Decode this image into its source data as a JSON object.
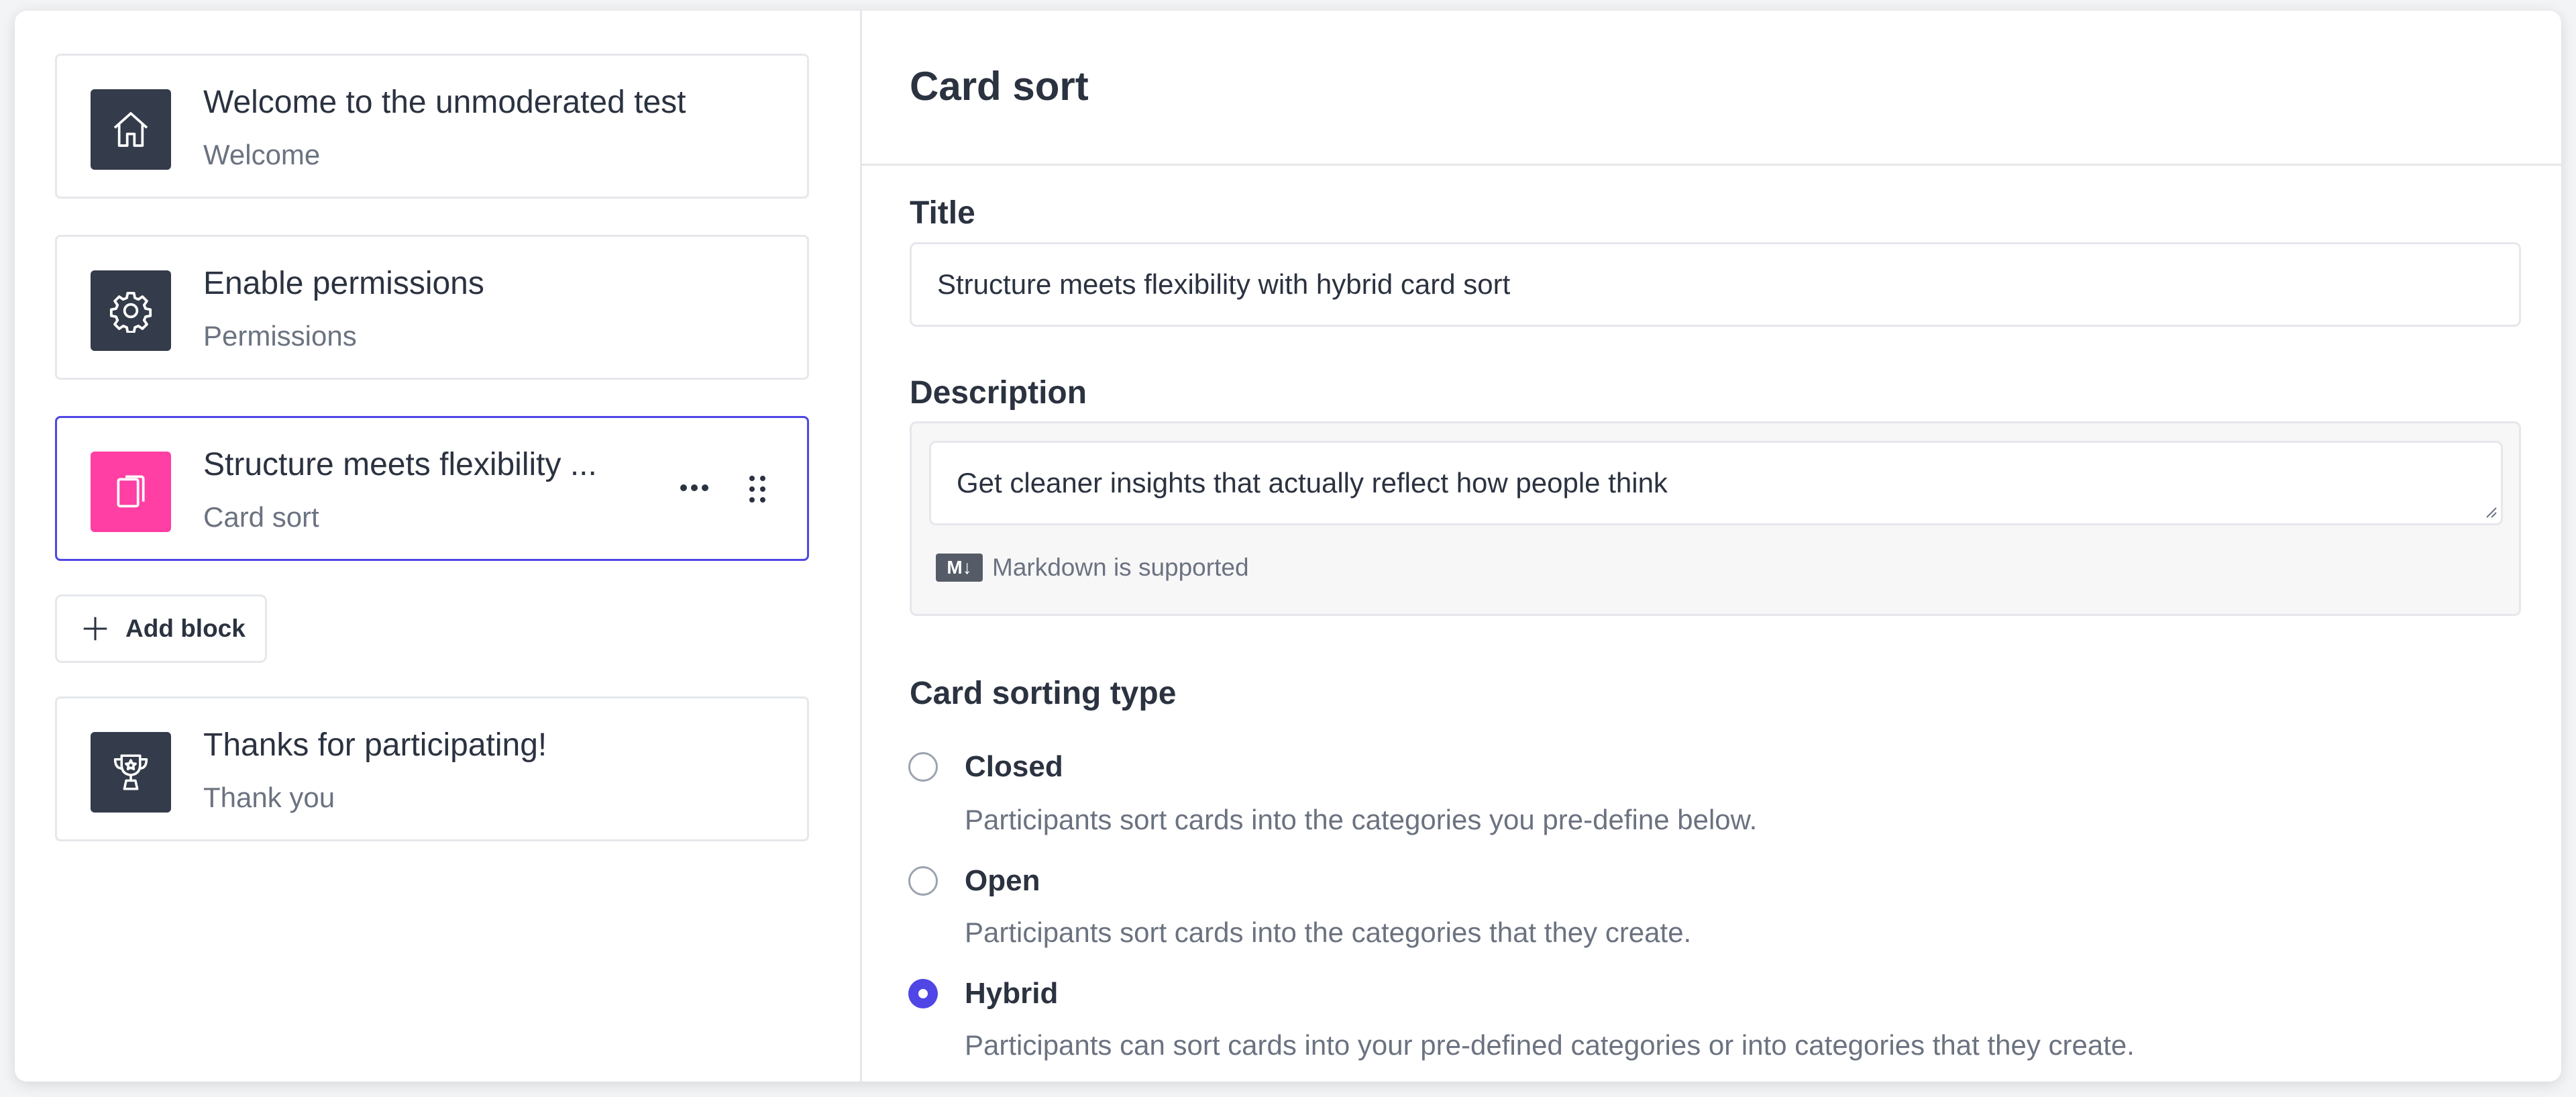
{
  "blocks": [
    {
      "title": "Welcome to the unmoderated test",
      "subtitle": "Welcome",
      "icon": "home-icon"
    },
    {
      "title": "Enable permissions",
      "subtitle": "Permissions",
      "icon": "gear-icon"
    },
    {
      "title": "Structure meets flexibility ...",
      "subtitle": "Card sort",
      "icon": "cards-icon",
      "selected": true
    },
    {
      "title": "Thanks for participating!",
      "subtitle": "Thank you",
      "icon": "trophy-icon"
    }
  ],
  "add_block_label": "Add block",
  "panel": {
    "title": "Card sort",
    "title_label": "Title",
    "title_value": "Structure meets flexibility with hybrid card sort",
    "description_label": "Description",
    "description_value": "Get cleaner insights that actually reflect how people think",
    "markdown_badge": "M↓",
    "markdown_note": "Markdown is supported",
    "sorting_type_label": "Card sorting type",
    "options": [
      {
        "label": "Closed",
        "description": "Participants sort cards into the categories you pre-define below.",
        "checked": false
      },
      {
        "label": "Open",
        "description": "Participants sort cards into the categories that they create.",
        "checked": false
      },
      {
        "label": "Hybrid",
        "description": "Participants can sort cards into your pre-defined categories or into categories that they create.",
        "checked": true
      }
    ]
  },
  "colors": {
    "accent": "#4f46e5",
    "pink": "#ff3fa4",
    "icon_dark": "#343b4a"
  }
}
